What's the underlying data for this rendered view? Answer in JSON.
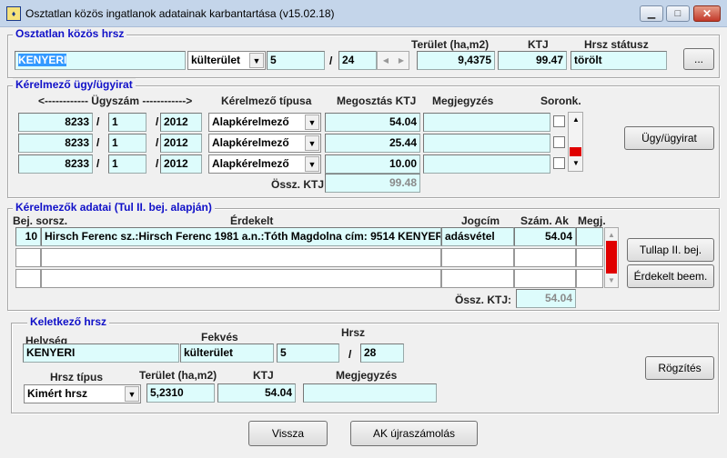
{
  "window": {
    "title": "Osztatlan közös ingatlanok adatainak karbantartása (v15.02.18)",
    "minimize": "▁",
    "maximize": "□",
    "close": "✕"
  },
  "hrsz_group": {
    "legend": "Osztatlan közös hrsz",
    "helyseg": "KENYERI",
    "fekves": "külterület",
    "hrsz1": "5",
    "slash": "/",
    "hrsz2": "24",
    "terulet_label": "Terület (ha,m2)",
    "terulet": "9,4375",
    "ktj_label": "KTJ",
    "ktj": "99.47",
    "status_label": "Hrsz státusz",
    "status": "törölt",
    "ellipsis": "..."
  },
  "kerelmezo_group": {
    "legend": "Kérelmező ügy/ügyirat",
    "ugyszam_label": "<------------ Ügyszám ------------>",
    "tipus_label": "Kérelmező típusa",
    "megosztas_label": "Megosztás KTJ",
    "megjegyzes_label": "Megjegyzés",
    "soronk_label": "Soronk.",
    "rows": [
      {
        "num": "8233",
        "sep1": "/",
        "part": "1",
        "sep2": "/",
        "year": "2012",
        "tipus": "Alapkérelmező",
        "ktj": "54.04",
        "megj": ""
      },
      {
        "num": "8233",
        "sep1": "/",
        "part": "1",
        "sep2": "/",
        "year": "2012",
        "tipus": "Alapkérelmező",
        "ktj": "25.44",
        "megj": ""
      },
      {
        "num": "8233",
        "sep1": "/",
        "part": "1",
        "sep2": "/",
        "year": "2012",
        "tipus": "Alapkérelmező",
        "ktj": "10.00",
        "megj": ""
      }
    ],
    "ossz_label": "Össz. KTJ:",
    "ossz": "99.48",
    "ugy_button": "Ügy/ügyirat"
  },
  "adatok_group": {
    "legend": "Kérelmezők adatai  (Tul II. bej. alapján)",
    "col_bej": "Bej. sorsz.",
    "col_erdekelt": "Érdekelt",
    "col_jogcim": "Jogcím",
    "col_szam": "Szám. Ak",
    "col_megj": "Megj.",
    "rows": [
      {
        "bej": "10",
        "erdekelt": "Hirsch Ferenc sz.:Hirsch Ferenc 1981 a.n.:Tóth Magdolna cím: 9514 KENYERI",
        "jogcim": "adásvétel",
        "szam": "54.04",
        "megj": ""
      },
      {
        "bej": "",
        "erdekelt": "",
        "jogcim": "",
        "szam": "",
        "megj": ""
      },
      {
        "bej": "",
        "erdekelt": "",
        "jogcim": "",
        "szam": "",
        "megj": ""
      }
    ],
    "ossz_label": "Össz. KTJ:",
    "ossz": "54.04",
    "tullap_button": "Tullap II. bej.",
    "erdekelt_button": "Érdekelt beem."
  },
  "keletkezo_group": {
    "legend": "Keletkező hrsz",
    "helyseg_label": "Helység",
    "helyseg": "KENYERI",
    "fekves_label": "Fekvés",
    "fekves": "külterület",
    "hrsz_label": "Hrsz",
    "hrsz1": "5",
    "slash": "/",
    "hrsz2": "28",
    "tipus_label": "Hrsz típus",
    "tipus": "Kimért hrsz",
    "terulet_label": "Terület (ha,m2)",
    "terulet": "5,2310",
    "ktj_label": "KTJ",
    "ktj": "54.04",
    "megj_label": "Megjegyzés",
    "megj": "",
    "rogzites_button": "Rögzítés"
  },
  "footer": {
    "vissza_button": "Vissza",
    "ak_button": "AK újraszámolás"
  }
}
